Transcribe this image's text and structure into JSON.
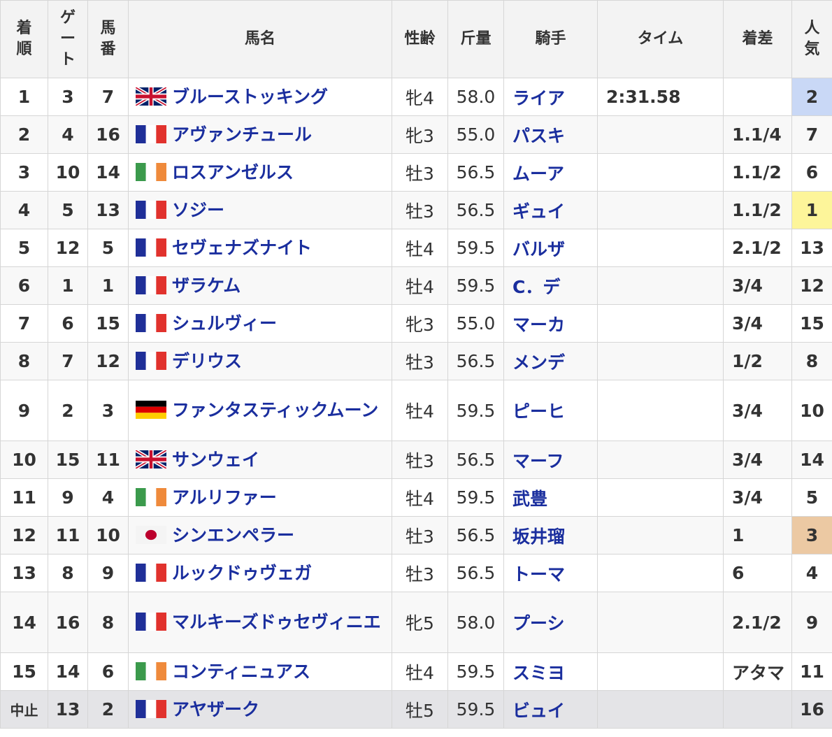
{
  "headers": {
    "finish": "着順",
    "gate": "ゲート",
    "number": "馬番",
    "horse": "馬名",
    "sexage": "性齢",
    "weight": "斤量",
    "jockey": "騎手",
    "time": "タイム",
    "margin": "着差",
    "popularity": "人気"
  },
  "rows": [
    {
      "finish": "1",
      "gate": "3",
      "number": "7",
      "flag": "gb",
      "horse": "ブルーストッキング",
      "sexage": "牝4",
      "weight": "58.0",
      "jockey": "ライア",
      "time": "2:31.58",
      "margin": "",
      "popularity": "2"
    },
    {
      "finish": "2",
      "gate": "4",
      "number": "16",
      "flag": "fr",
      "horse": "アヴァンチュール",
      "sexage": "牝3",
      "weight": "55.0",
      "jockey": "パスキ",
      "time": "",
      "margin": "1.1/4",
      "popularity": "7"
    },
    {
      "finish": "3",
      "gate": "10",
      "number": "14",
      "flag": "ie",
      "horse": "ロスアンゼルス",
      "sexage": "牡3",
      "weight": "56.5",
      "jockey": "ムーア",
      "time": "",
      "margin": "1.1/2",
      "popularity": "6"
    },
    {
      "finish": "4",
      "gate": "5",
      "number": "13",
      "flag": "fr",
      "horse": "ソジー",
      "sexage": "牡3",
      "weight": "56.5",
      "jockey": "ギュイ",
      "time": "",
      "margin": "1.1/2",
      "popularity": "1"
    },
    {
      "finish": "5",
      "gate": "12",
      "number": "5",
      "flag": "fr",
      "horse": "セヴェナズナイト",
      "sexage": "牡4",
      "weight": "59.5",
      "jockey": "バルザ",
      "time": "",
      "margin": "2.1/2",
      "popularity": "13"
    },
    {
      "finish": "6",
      "gate": "1",
      "number": "1",
      "flag": "fr",
      "horse": "ザラケム",
      "sexage": "牡4",
      "weight": "59.5",
      "jockey": "C．デ",
      "time": "",
      "margin": "3/4",
      "popularity": "12"
    },
    {
      "finish": "7",
      "gate": "6",
      "number": "15",
      "flag": "fr",
      "horse": "シュルヴィー",
      "sexage": "牝3",
      "weight": "55.0",
      "jockey": "マーカ",
      "time": "",
      "margin": "3/4",
      "popularity": "15"
    },
    {
      "finish": "8",
      "gate": "7",
      "number": "12",
      "flag": "fr",
      "horse": "デリウス",
      "sexage": "牡3",
      "weight": "56.5",
      "jockey": "メンデ",
      "time": "",
      "margin": "1/2",
      "popularity": "8"
    },
    {
      "finish": "9",
      "gate": "2",
      "number": "3",
      "flag": "de",
      "horse": "ファンタスティックムーン",
      "sexage": "牡4",
      "weight": "59.5",
      "jockey": "ピーヒ",
      "time": "",
      "margin": "3/4",
      "popularity": "10"
    },
    {
      "finish": "10",
      "gate": "15",
      "number": "11",
      "flag": "gb",
      "horse": "サンウェイ",
      "sexage": "牡3",
      "weight": "56.5",
      "jockey": "マーフ",
      "time": "",
      "margin": "3/4",
      "popularity": "14"
    },
    {
      "finish": "11",
      "gate": "9",
      "number": "4",
      "flag": "ie",
      "horse": "アルリファー",
      "sexage": "牡4",
      "weight": "59.5",
      "jockey": "武豊",
      "time": "",
      "margin": "3/4",
      "popularity": "5"
    },
    {
      "finish": "12",
      "gate": "11",
      "number": "10",
      "flag": "jp",
      "horse": "シンエンペラー",
      "sexage": "牡3",
      "weight": "56.5",
      "jockey": "坂井瑠",
      "time": "",
      "margin": "1",
      "popularity": "3"
    },
    {
      "finish": "13",
      "gate": "8",
      "number": "9",
      "flag": "fr",
      "horse": "ルックドゥヴェガ",
      "sexage": "牡3",
      "weight": "56.5",
      "jockey": "トーマ",
      "time": "",
      "margin": "6",
      "popularity": "4"
    },
    {
      "finish": "14",
      "gate": "16",
      "number": "8",
      "flag": "fr",
      "horse": "マルキーズドゥセヴィニエ",
      "sexage": "牝5",
      "weight": "58.0",
      "jockey": "プーシ",
      "time": "",
      "margin": "2.1/2",
      "popularity": "9"
    },
    {
      "finish": "15",
      "gate": "14",
      "number": "6",
      "flag": "ie",
      "horse": "コンティニュアス",
      "sexage": "牡4",
      "weight": "59.5",
      "jockey": "スミヨ",
      "time": "",
      "margin": "アタマ",
      "popularity": "11"
    },
    {
      "finish": "中止",
      "gate": "13",
      "number": "2",
      "flag": "fr",
      "horse": "アヤザーク",
      "sexage": "牡5",
      "weight": "59.5",
      "jockey": "ビュイ",
      "time": "",
      "margin": "",
      "popularity": "16"
    }
  ],
  "colors": {
    "link": "#1a2e9e",
    "popularity_1": "#fdf59a",
    "popularity_2": "#c9d8f6",
    "popularity_3": "#ecc9a3",
    "header_bg": "#f3f3f3",
    "stopped_row_bg": "#e4e4e7"
  }
}
